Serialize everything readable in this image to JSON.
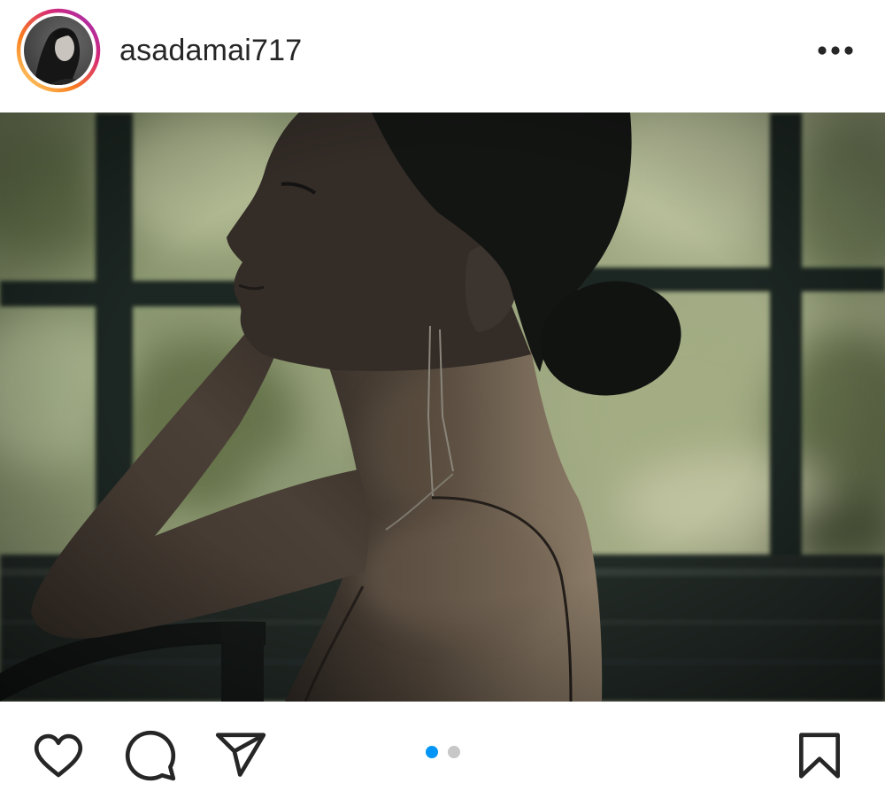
{
  "post": {
    "username": "asadamai717",
    "avatar_ring_colors": [
      "#feda75",
      "#fa7e1e",
      "#d62976",
      "#962fbf"
    ],
    "more_icon": "more-horizontal-icon"
  },
  "media": {
    "carousel": {
      "count": 2,
      "active_index": 0
    }
  },
  "actions": {
    "like_icon": "heart-icon",
    "comment_icon": "comment-icon",
    "share_icon": "send-icon",
    "save_icon": "bookmark-icon"
  },
  "colors": {
    "text": "#262626",
    "accent": "#0095f6",
    "dot_inactive": "#c7c7c7",
    "background": "#ffffff"
  }
}
